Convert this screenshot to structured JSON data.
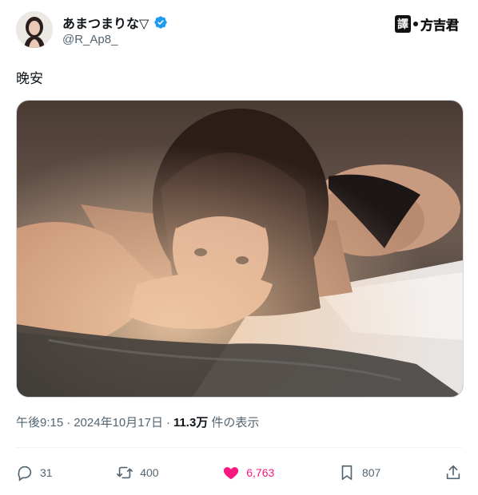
{
  "author": {
    "display_name": "あまつまりな▽",
    "handle": "@R_Ap8_",
    "verified": true
  },
  "watermark": {
    "box_label": "譯",
    "text": "方吉君"
  },
  "tweet": {
    "text": "晚安"
  },
  "meta": {
    "time": "午後9:15",
    "sep1": "·",
    "date": "2024年10月17日",
    "sep2": "·",
    "views": "11.3万",
    "views_label": "件の表示"
  },
  "actions": {
    "replies": "31",
    "retweets": "400",
    "likes": "6,763",
    "bookmarks": "807"
  },
  "colors": {
    "like_active": "#f91880",
    "muted": "#536471",
    "verified": "#1d9bf0"
  }
}
